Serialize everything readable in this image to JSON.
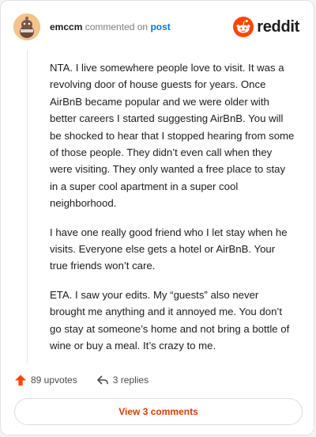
{
  "comment": {
    "username": "emccm",
    "commented_on": "commented on",
    "post_link": "post",
    "paragraphs": [
      "NTA. I live somewhere people love to visit. It was a revolving door of house guests for years. Once AirBnB became popular and we were older with better careers I started suggesting AirBnB. You will be shocked to hear that I stopped hearing from some of those people. They didn’t even call when they were visiting. They only wanted a free place to stay in a super cool apartment in a super cool neighborhood.",
      "I have one really good friend who I let stay when he visits. Everyone else gets a hotel or AirBnB. Your true friends won’t care.",
      "ETA. I saw your edits. My “guests” also never brought me anything and it annoyed me. You don’t go stay at someone’s home and not bring a bottle of wine or buy a meal. It’s crazy to me."
    ]
  },
  "brand": {
    "name": "reddit",
    "icon": "reddit-snoo-icon",
    "color": "#ff4500"
  },
  "actions": {
    "upvotes": "89 upvotes",
    "replies": "3 replies",
    "upvote_icon": "upvote-arrow-icon",
    "reply_icon": "reply-arrow-icon"
  },
  "footer": {
    "view_comments": "View 3 comments"
  },
  "colors": {
    "accent": "#ff4500",
    "link": "#0079d3",
    "cta_text": "#d93a00"
  }
}
